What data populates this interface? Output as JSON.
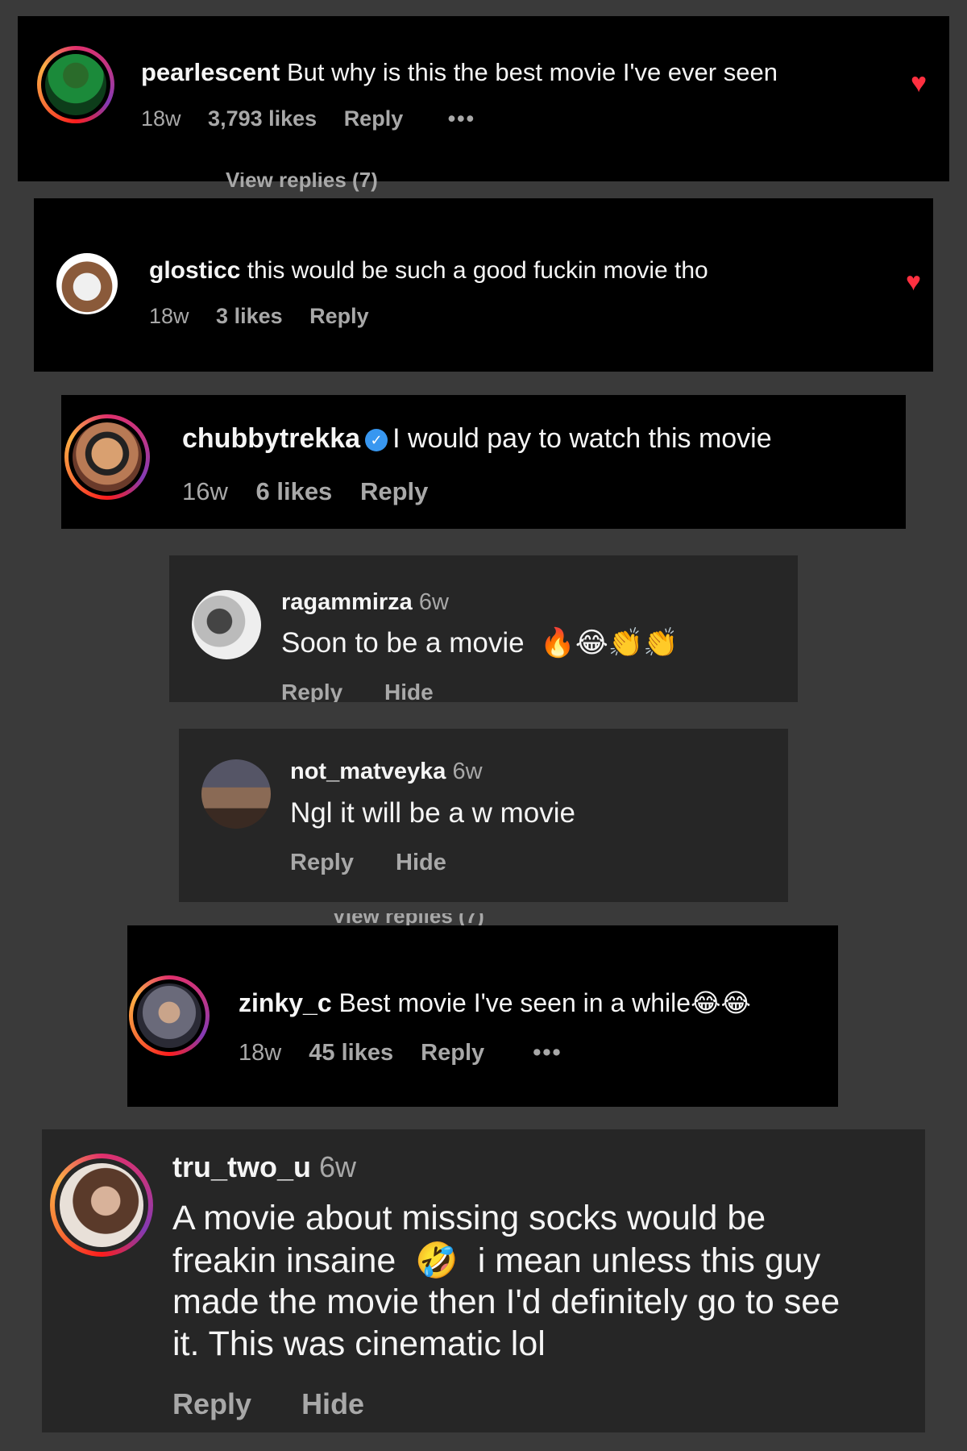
{
  "colors": {
    "background": "#3a3a3a",
    "card_black": "#000000",
    "card_gray": "#262626",
    "heart": "#ff3040",
    "verified": "#3897f0",
    "meta": "#a8a8a8"
  },
  "comments": [
    {
      "user": "pearlescent",
      "text": "But why is this the best movie I've ever seen",
      "time": "18w",
      "likes": "3,793 likes",
      "reply": "Reply",
      "more": "•••",
      "liked": true
    },
    {
      "user": "glosticc",
      "text": "this would be such a good fuckin movie tho",
      "time": "18w",
      "likes": "3 likes",
      "reply": "Reply",
      "liked": true
    },
    {
      "user": "chubbytrekka",
      "text": "I would pay to watch this movie",
      "time": "16w",
      "likes": "6 likes",
      "reply": "Reply",
      "verified": true
    },
    {
      "user": "ragammirza",
      "time": "6w",
      "text": "Soon to be a movie",
      "emojis": "🔥😂👏👏",
      "reply": "Reply",
      "hide": "Hide"
    },
    {
      "user": "not_matveyka",
      "time": "6w",
      "text": "Ngl it will be a w movie",
      "reply": "Reply",
      "hide": "Hide"
    },
    {
      "user": "zinky_c",
      "text": "Best movie I've seen in a while",
      "emojis": "😂😂",
      "time": "18w",
      "likes": "45 likes",
      "reply": "Reply",
      "more": "•••"
    },
    {
      "user": "tru_two_u",
      "time": "6w",
      "text_lines": [
        "A movie about missing socks would be",
        "freakin insaine",
        "i mean unless this guy",
        "made the movie then I'd definitely go to see",
        "it. This was cinematic lol"
      ],
      "emoji": "🤣",
      "reply": "Reply",
      "hide": "Hide"
    }
  ],
  "view_replies": "View replies (7)"
}
